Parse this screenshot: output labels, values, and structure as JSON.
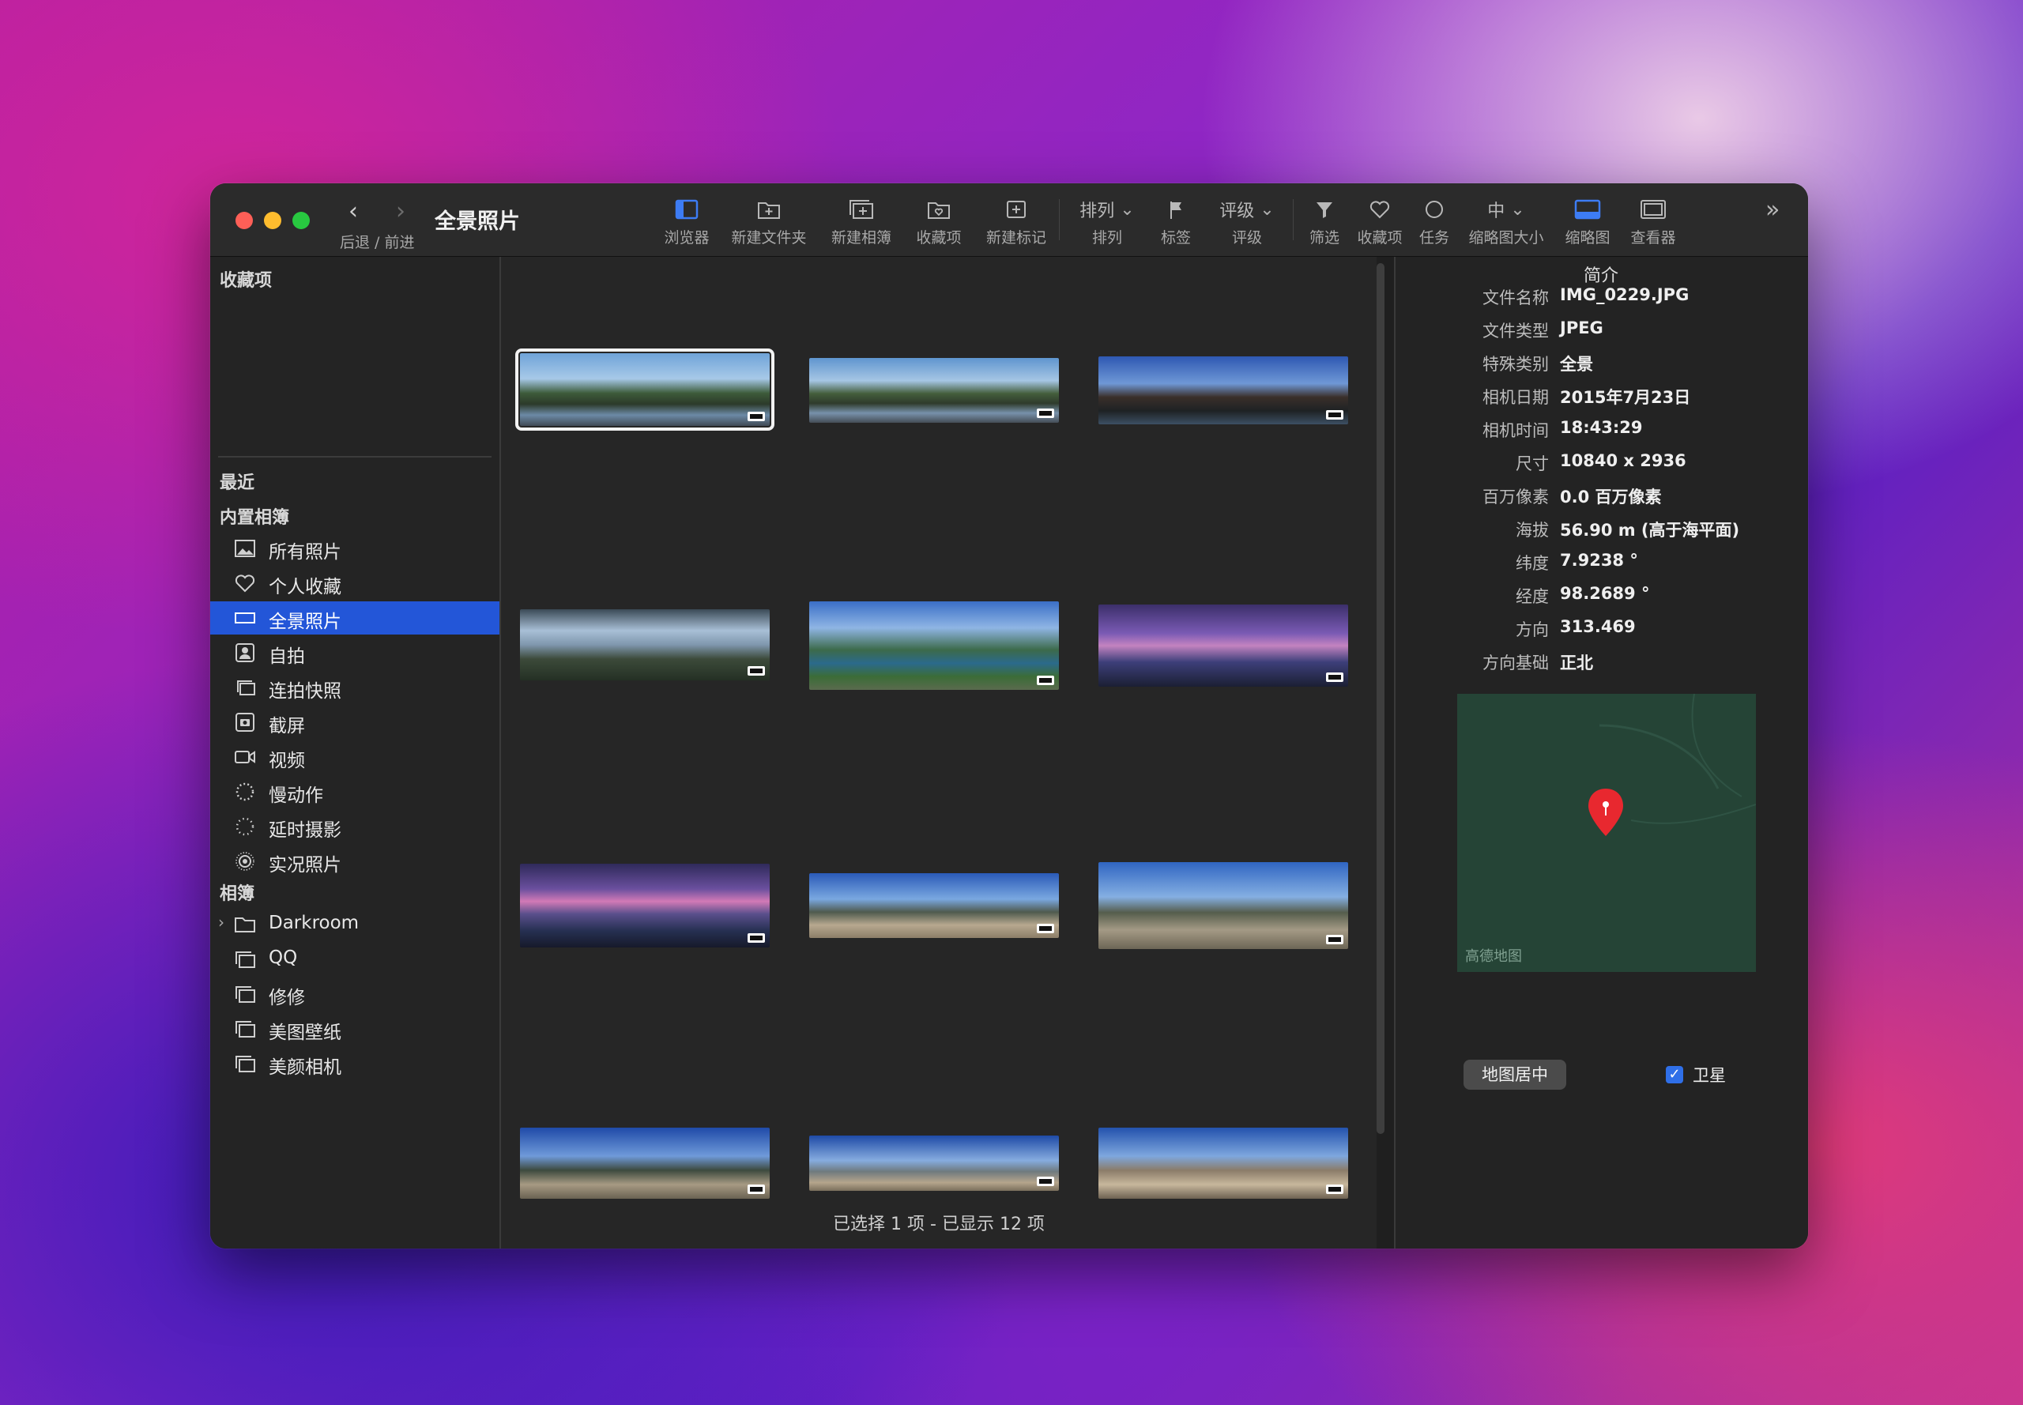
{
  "window": {
    "title": "全景照片",
    "nav_label": "后退 / 前进"
  },
  "toolbar": {
    "browser": "浏览器",
    "new_folder": "新建文件夹",
    "new_album": "新建相簿",
    "favorites": "收藏项",
    "new_marker": "新建标记",
    "sort_value": "排列",
    "sort": "排列",
    "tags": "标签",
    "rating_value": "评级",
    "rating": "评级",
    "filter": "筛选",
    "fav2": "收藏项",
    "tasks": "任务",
    "thumb_size_value": "中",
    "thumb_size": "缩略图大小",
    "thumbnails": "缩略图",
    "viewer": "查看器"
  },
  "sidebar": {
    "favorites_header": "收藏项",
    "recent_header": "最近",
    "builtin_header": "内置相簿",
    "builtin": [
      {
        "label": "所有照片",
        "icon": "photo-icon"
      },
      {
        "label": "个人收藏",
        "icon": "heart-icon"
      },
      {
        "label": "全景照片",
        "icon": "panorama-icon",
        "selected": true
      },
      {
        "label": "自拍",
        "icon": "selfie-icon"
      },
      {
        "label": "连拍快照",
        "icon": "burst-icon"
      },
      {
        "label": "截屏",
        "icon": "screenshot-icon"
      },
      {
        "label": "视频",
        "icon": "video-icon"
      },
      {
        "label": "慢动作",
        "icon": "slowmo-icon"
      },
      {
        "label": "延时摄影",
        "icon": "timelapse-icon"
      },
      {
        "label": "实况照片",
        "icon": "live-photo-icon"
      }
    ],
    "albums_header": "相簿",
    "albums": [
      {
        "label": "Darkroom",
        "icon": "folder-icon"
      },
      {
        "label": "QQ",
        "icon": "album-icon"
      },
      {
        "label": "修修",
        "icon": "album-icon"
      },
      {
        "label": "美图壁纸",
        "icon": "album-icon"
      },
      {
        "label": "美颜相机",
        "icon": "album-icon"
      }
    ]
  },
  "status": "已选择  1 项 - 已显示 12 项",
  "inspector": {
    "title": "简介",
    "rows": [
      {
        "k": "文件名称",
        "v": "IMG_0229.JPG"
      },
      {
        "k": "文件类型",
        "v": "JPEG"
      },
      {
        "k": "特殊类别",
        "v": "全景"
      },
      {
        "k": "相机日期",
        "v": "2015年7月23日"
      },
      {
        "k": "相机时间",
        "v": "18:43:29"
      },
      {
        "k": "尺寸",
        "v": "10840 x 2936"
      },
      {
        "k": "百万像素",
        "v": "0.0 百万像素"
      },
      {
        "k": "海拔",
        "v": "56.90 m (高于海平面)"
      },
      {
        "k": "纬度",
        "v": "7.9238 °"
      },
      {
        "k": "经度",
        "v": "98.2689 °"
      },
      {
        "k": "方向",
        "v": "313.469"
      },
      {
        "k": "方向基础",
        "v": "正北"
      }
    ],
    "map_credit": "高德地图",
    "center_button": "地图居中",
    "satellite_label": "卫星"
  }
}
